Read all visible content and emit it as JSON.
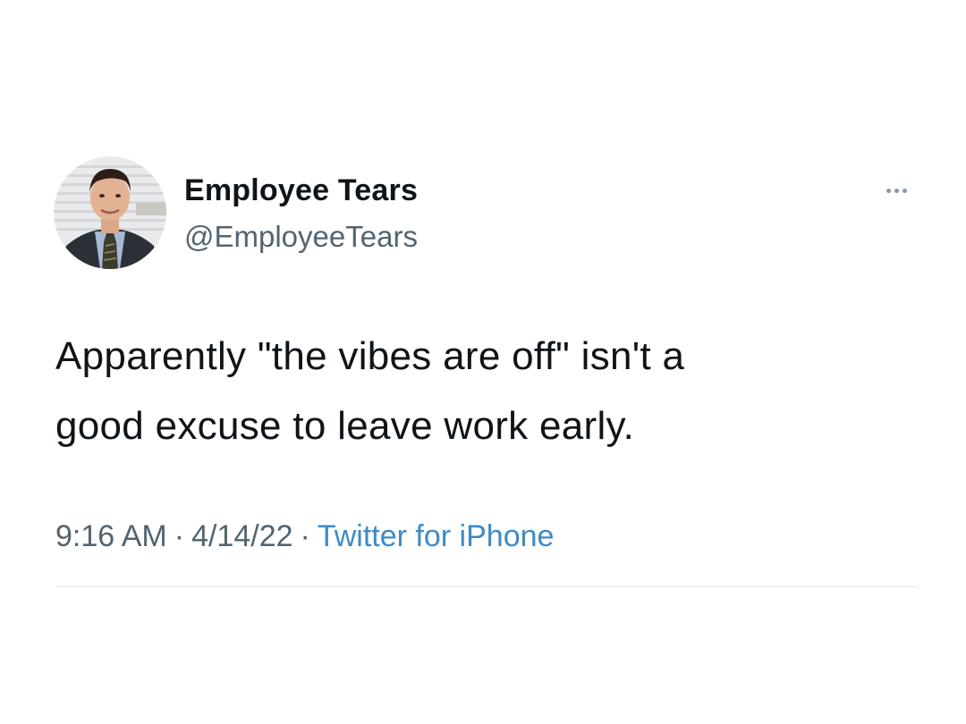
{
  "tweet": {
    "author": {
      "display_name": "Employee Tears",
      "handle": "@EmployeeTears"
    },
    "text": "Apparently \"the vibes are off\" isn't a\ngood excuse to leave work early.",
    "meta": {
      "time": "9:16 AM",
      "separator": "·",
      "date": "4/14/22",
      "source": "Twitter for iPhone"
    },
    "icons": {
      "more": "more-options-icon"
    }
  },
  "colors": {
    "text": "#0f1419",
    "secondary": "#536471",
    "source_link": "#3e8ac7",
    "divider": "#e7ebee"
  }
}
